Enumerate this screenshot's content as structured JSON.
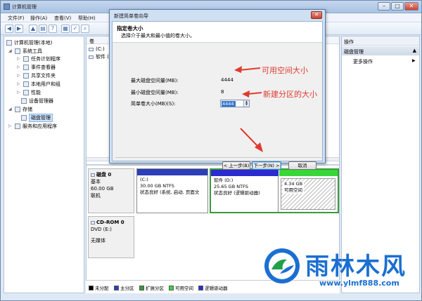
{
  "window": {
    "title": "计算机管理"
  },
  "menu": [
    "文件(F)",
    "操作(A)",
    "查看(V)",
    "帮助(H)"
  ],
  "tree": {
    "root": "计算机管理(本地)",
    "system_tools": "系统工具",
    "task_scheduler": "任务计划程序",
    "event_viewer": "事件查看器",
    "shared_folders": "共享文件夹",
    "local_users": "本地用户和组",
    "performance": "性能",
    "device_manager": "设备管理器",
    "storage": "存储",
    "disk_management": "磁盘管理",
    "services": "服务和应用程序"
  },
  "center": {
    "header_col": "卷",
    "vol1": "(C:)",
    "vol2": "软件 ("
  },
  "disk0": {
    "name": "磁盘 0",
    "type": "基本",
    "size": "60.00 GB",
    "status": "联机"
  },
  "partitions": [
    {
      "name": "(C:)",
      "size": "30.00 GB NTFS",
      "status": "状态良好 (系统, 启动, 页面文"
    },
    {
      "name": "软件 (D:)",
      "size": "25.65 GB NTFS",
      "status": "状态良好 (逻辑驱动器)"
    },
    {
      "name": "",
      "size": "4.34 GB",
      "status": "可用空间"
    }
  ],
  "cdrom": {
    "name": "CD-ROM 0",
    "drive": "DVD (E:)",
    "media": "无媒体"
  },
  "legend": [
    "未分配",
    "主分区",
    "扩展分区",
    "可用空间",
    "逻辑驱动器"
  ],
  "legend_colors": [
    "#000000",
    "#2c3fb8",
    "#3a9a3a",
    "#38d638",
    "#2b2bd0"
  ],
  "actions": {
    "title": "操作",
    "section": "磁盘管理",
    "more": "更多操作"
  },
  "dialog": {
    "title": "新建简单卷向导",
    "heading": "指定卷大小",
    "subheading": "选择介于最大和最小值的卷大小。",
    "max_label": "最大磁盘空间量(MB):",
    "max_value": "4444",
    "min_label": "最小磁盘空间量(MB):",
    "min_value": "8",
    "size_label": "简单卷大小(MB)(S):",
    "size_value": "4444",
    "back": "< 上一步(B)",
    "next": "下一步(N) >",
    "cancel": "取消"
  },
  "annotations": {
    "available": "可用空间大小",
    "new_size": "新建分区的大小"
  },
  "watermark": {
    "brand": "雨林木风",
    "url": "www.ylmf888.com"
  },
  "colors": {
    "annotation": "#e03a2f",
    "brand_blue": "#1a6fd1"
  }
}
